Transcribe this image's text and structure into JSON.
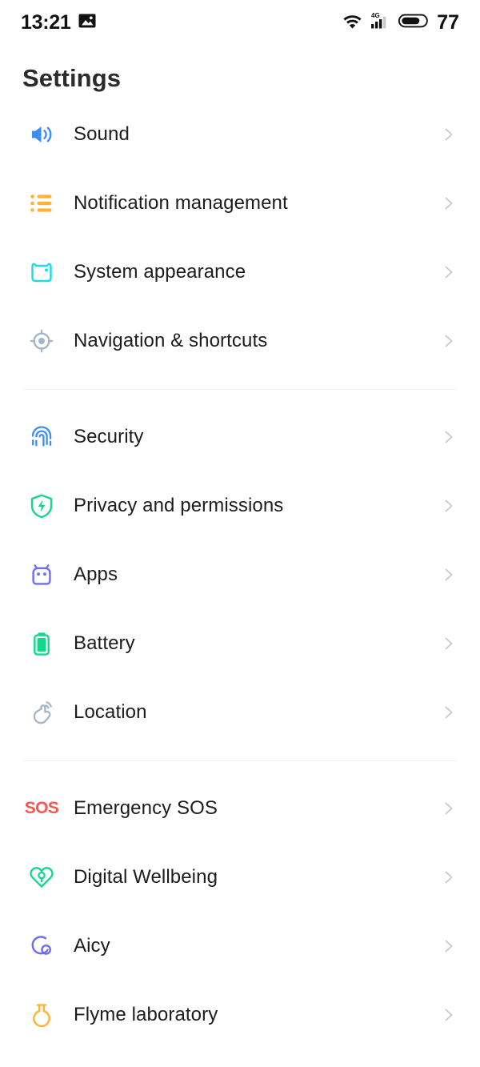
{
  "status_bar": {
    "time": "13:21",
    "image_icon": "image-icon",
    "wifi_icon": "wifi-icon",
    "network_type": "4G",
    "signal_icon": "cellular-signal-icon",
    "battery_icon": "battery-icon",
    "battery_level": "77"
  },
  "header": {
    "title": "Settings"
  },
  "colors": {
    "sound": "#3d8cf7",
    "notification": "#ffb330",
    "system_appearance": "#12dcf0",
    "navigation": "#a3b5c9",
    "security": "#3d8cf7",
    "privacy": "#12d98a",
    "apps": "#6c6cf5",
    "battery": "#12d98a",
    "location": "#a3b5c9",
    "emergency_sos": "#f7574f",
    "digital_wellbeing": "#12d98a",
    "aicy": "#6c6cf5",
    "flyme_laboratory": "#ffb330",
    "chevron": "#c8c8cc",
    "divider": "#f1f2f4"
  },
  "groups": [
    {
      "name": "group-1",
      "items": [
        {
          "label": "Sound",
          "icon": "volume-speaker-icon",
          "chevron": "chevron-right-icon"
        },
        {
          "label": "Notification management",
          "icon": "bulleted-list-icon",
          "chevron": "chevron-right-icon"
        },
        {
          "label": "System appearance",
          "icon": "appearance-icon",
          "chevron": "chevron-right-icon"
        },
        {
          "label": "Navigation & shortcuts",
          "icon": "target-crosshair-icon",
          "chevron": "chevron-right-icon"
        }
      ]
    },
    {
      "name": "group-2",
      "items": [
        {
          "label": "Security",
          "icon": "fingerprint-icon",
          "chevron": "chevron-right-icon"
        },
        {
          "label": "Privacy and permissions",
          "icon": "shield-bolt-icon",
          "chevron": "chevron-right-icon"
        },
        {
          "label": "Apps",
          "icon": "android-robot-icon",
          "chevron": "chevron-right-icon"
        },
        {
          "label": "Battery",
          "icon": "battery-icon",
          "chevron": "chevron-right-icon"
        },
        {
          "label": "Location",
          "icon": "location-tap-icon",
          "chevron": "chevron-right-icon"
        }
      ]
    },
    {
      "name": "group-3",
      "items": [
        {
          "label": "Emergency SOS",
          "icon": "sos-text-icon",
          "icon_text": "SOS",
          "chevron": "chevron-right-icon"
        },
        {
          "label": "Digital Wellbeing",
          "icon": "heart-spiral-icon",
          "chevron": "chevron-right-icon"
        },
        {
          "label": "Aicy",
          "icon": "aicy-circle-icon",
          "chevron": "chevron-right-icon"
        },
        {
          "label": "Flyme laboratory",
          "icon": "flask-icon",
          "chevron": "chevron-right-icon"
        }
      ]
    }
  ]
}
